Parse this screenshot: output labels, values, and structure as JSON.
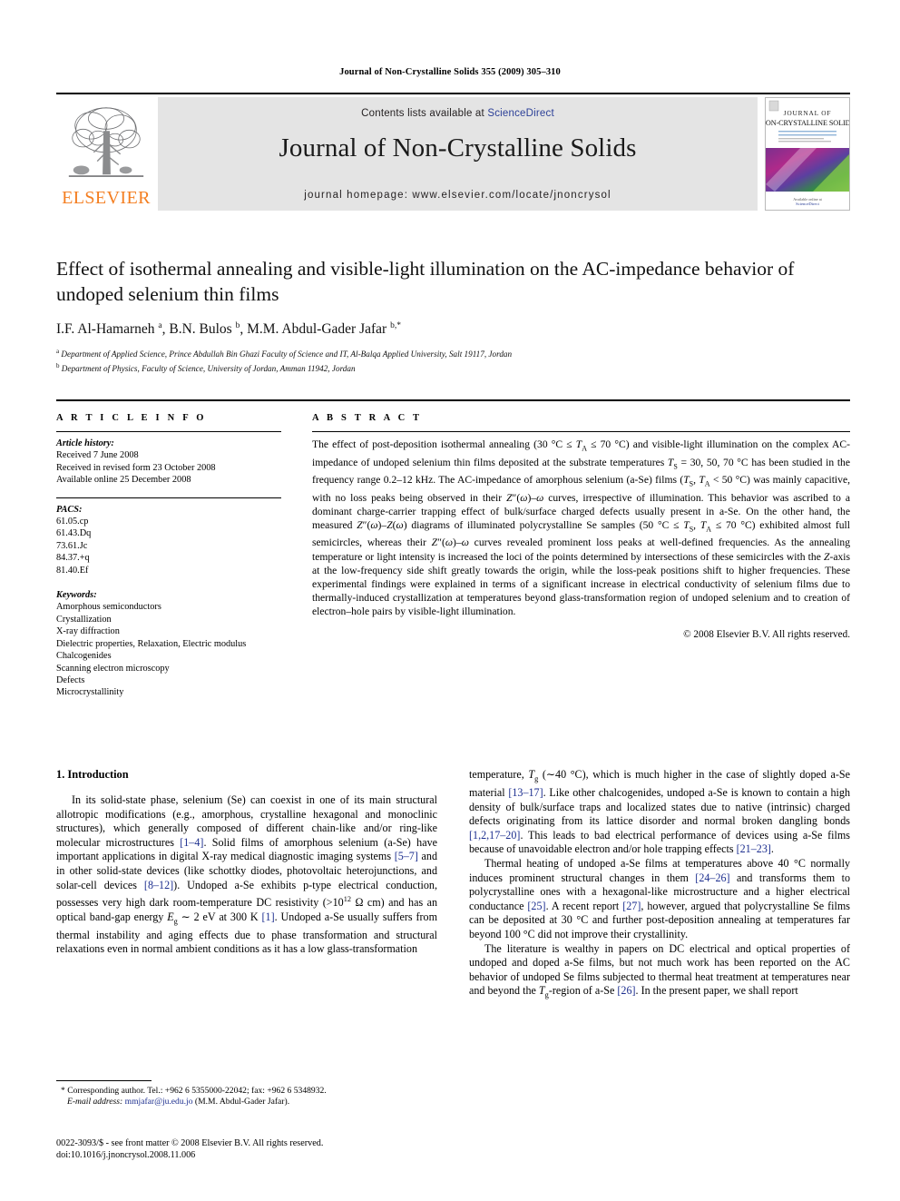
{
  "running_head": "Journal of Non-Crystalline Solids 355 (2009) 305–310",
  "masthead": {
    "publisher_name": "ELSEVIER",
    "contents_prefix": "Contents lists available at ",
    "sciencedirect_link": "ScienceDirect",
    "journal_title": "Journal of Non-Crystalline Solids",
    "homepage": "journal homepage: www.elsevier.com/locate/jnoncrysol",
    "cover": {
      "line1": "JOURNAL OF",
      "line2": "NON-CRYSTALLINE SOLIDS",
      "footer": "ScienceDirect"
    }
  },
  "article": {
    "title": "Effect of isothermal annealing and visible-light illumination on the AC-impedance behavior of undoped selenium thin films",
    "authors_html": "I.F. Al-Hamarneh <sup>a</sup>, B.N. Bulos <sup>b</sup>, M.M. Abdul-Gader Jafar <sup>b,*</sup>",
    "affiliation_a": "Department of Applied Science, Prince Abdullah Bin Ghazi Faculty of Science and IT, Al-Balqa Applied University, Salt 19117, Jordan",
    "affiliation_b": "Department of Physics, Faculty of Science, University of Jordan, Amman 11942, Jordan"
  },
  "article_info": {
    "heading": "A R T I C L E   I N F O",
    "history_label": "Article history:",
    "history": [
      "Received 7 June 2008",
      "Received in revised form 23 October 2008",
      "Available online 25 December 2008"
    ],
    "pacs_label": "PACS:",
    "pacs": [
      "61.05.cp",
      "61.43.Dq",
      "73.61.Jc",
      "84.37.+q",
      "81.40.Ef"
    ],
    "keywords_label": "Keywords:",
    "keywords": [
      "Amorphous semiconductors",
      "Crystallization",
      "X-ray diffraction",
      "Dielectric properties, Relaxation, Electric modulus",
      "Chalcogenides",
      "Scanning electron microscopy",
      "Defects",
      "Microcrystallinity"
    ]
  },
  "abstract": {
    "heading": "A B S T R A C T",
    "text_html": "The effect of post-deposition isothermal annealing (30 °C ≤ <i>T</i><sub>A</sub> ≤ 70 °C) and visible-light illumination on the complex AC-impedance of undoped selenium thin films deposited at the substrate temperatures <i>T</i><sub>S</sub> = 30, 50, 70 °C has been studied in the frequency range 0.2–12 kHz. The AC-impedance of amorphous selenium (a-Se) films (<i>T</i><sub>S</sub>, <i>T</i><sub>A</sub> &lt; 50 °C) was mainly capacitive, with no loss peaks being observed in their <i>Z</i>″(<i>ω</i>)–<i>ω</i> curves, irrespective of illumination. This behavior was ascribed to a dominant charge-carrier trapping effect of bulk/surface charged defects usually present in a-Se. On the other hand, the measured <i>Z</i>″(<i>ω</i>)–<i>Z</i>(<i>ω</i>) diagrams of illuminated polycrystalline Se samples (50 °C ≤ <i>T</i><sub>S</sub>, <i>T</i><sub>A</sub> ≤ 70 °C) exhibited almost full semicircles, whereas their <i>Z</i>″(<i>ω</i>)–<i>ω</i> curves revealed prominent loss peaks at well-defined frequencies. As the annealing temperature or light intensity is increased the loci of the points determined by intersections of these semicircles with the <i>Z</i>-axis at the low-frequency side shift greatly towards the origin, while the loss-peak positions shift to higher frequencies. These experimental findings were explained in terms of a significant increase in electrical conductivity of selenium films due to thermally-induced crystallization at temperatures beyond glass-transformation region of undoped selenium and to creation of electron–hole pairs by visible-light illumination.",
    "copyright": "© 2008 Elsevier B.V. All rights reserved."
  },
  "body": {
    "section_heading": "1. Introduction",
    "left_para1_html": "In its solid-state phase, selenium (Se) can coexist in one of its main structural allotropic modifications (e.g., amorphous, crystalline hexagonal and monoclinic structures), which generally composed of different chain-like and/or ring-like molecular microstructures <span class=\"ref\">[1–4]</span>. Solid films of amorphous selenium (a-Se) have important applications in digital X-ray medical diagnostic imaging systems <span class=\"ref\">[5–7]</span> and in other solid-state devices (like schottky diodes, photovoltaic heterojunctions, and solar-cell devices <span class=\"ref\">[8–12]</span>). Undoped a-Se exhibits p-type electrical conduction, possesses very high dark room-temperature DC resistivity (&gt;10<sup>12</sup> Ω cm) and has an optical band-gap energy <i>E</i><sub>g</sub> ∼ 2 eV at 300 K <span class=\"ref\">[1]</span>. Undoped a-Se usually suffers from thermal instability and aging effects due to phase transformation and structural relaxations even in normal ambient conditions as it has a low glass-transformation",
    "right_para1_html": "temperature, <i>T</i><sub>g</sub> (∼40 °C), which is much higher in the case of slightly doped a-Se material <span class=\"ref\">[13–17]</span>. Like other chalcogenides, undoped a-Se is known to contain a high density of bulk/surface traps and localized states due to native (intrinsic) charged defects originating from its lattice disorder and normal broken dangling bonds <span class=\"ref\">[1,2,17–20]</span>. This leads to bad electrical performance of devices using a-Se films because of unavoidable electron and/or hole trapping effects <span class=\"ref\">[21–23]</span>.",
    "right_para2_html": "Thermal heating of undoped a-Se films at temperatures above 40 °C normally induces prominent structural changes in them <span class=\"ref\">[24–26]</span> and transforms them to polycrystalline ones with a hexagonal-like microstructure and a higher electrical conductance <span class=\"ref\">[25]</span>. A recent report <span class=\"ref\">[27]</span>, however, argued that polycrystalline Se films can be deposited at 30 °C and further post-deposition annealing at temperatures far beyond 100 °C did not improve their crystallinity.",
    "right_para3_html": "The literature is wealthy in papers on DC electrical and optical properties of undoped and doped a-Se films, but not much work has been reported on the AC behavior of undoped Se films subjected to thermal heat treatment at temperatures near and beyond the <i>T</i><sub>g</sub>-region of a-Se <span class=\"ref\">[26]</span>. In the present paper, we shall report"
  },
  "footnote": {
    "marker": "*",
    "corresponding_html": "Corresponding author. Tel.: +962 6 5355000-22042; fax: +962 6 5348932.",
    "email_label": "E-mail address:",
    "email": "mmjafar@ju.edu.jo",
    "email_owner": "(M.M. Abdul-Gader Jafar)."
  },
  "page_footer": {
    "line1": "0022-3093/$ - see front matter © 2008 Elsevier B.V. All rights reserved.",
    "line2": "doi:10.1016/j.jnoncrysol.2008.11.006"
  },
  "colors": {
    "link_blue": "#2b3f97",
    "ref_blue": "#1d2f8f",
    "elsevier_orange": "#F47E20",
    "band_gray": "#e4e4e4"
  }
}
